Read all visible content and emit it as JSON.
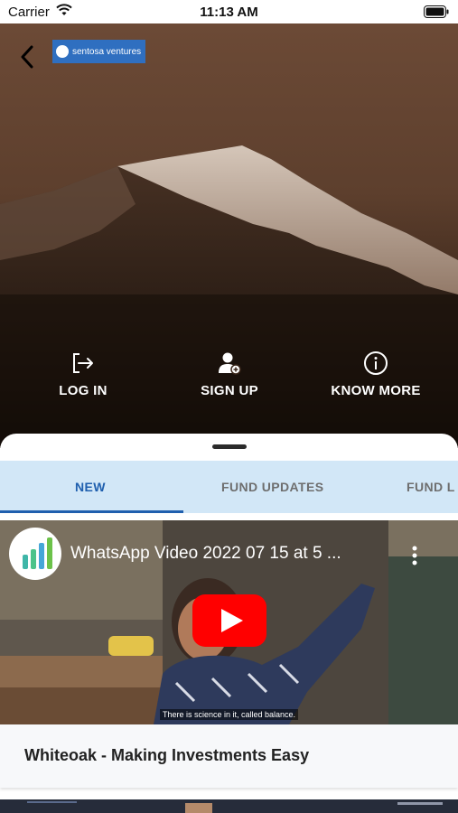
{
  "status_bar": {
    "carrier": "Carrier",
    "time": "11:13 AM"
  },
  "header": {
    "brand_logo_text": "sentosa ventures"
  },
  "actions": [
    {
      "label": "LOG IN",
      "icon": "login-icon"
    },
    {
      "label": "SIGN UP",
      "icon": "add-user-icon"
    },
    {
      "label": "KNOW MORE",
      "icon": "info-icon"
    }
  ],
  "tabs": [
    {
      "label": "NEW",
      "active": true
    },
    {
      "label": "FUND UPDATES",
      "active": false
    },
    {
      "label": "FUND L",
      "active": false
    }
  ],
  "video": {
    "title": "WhatsApp Video 2022 07 15 at 5 ...",
    "caption": "There is science in it, called balance."
  },
  "card": {
    "title": "Whiteoak - Making Investments Easy"
  },
  "colors": {
    "accent": "#1f5fae",
    "tab_bar_bg": "#d2e7f7",
    "play_red": "#ff0000",
    "brand_blue": "#2f6fc0"
  }
}
